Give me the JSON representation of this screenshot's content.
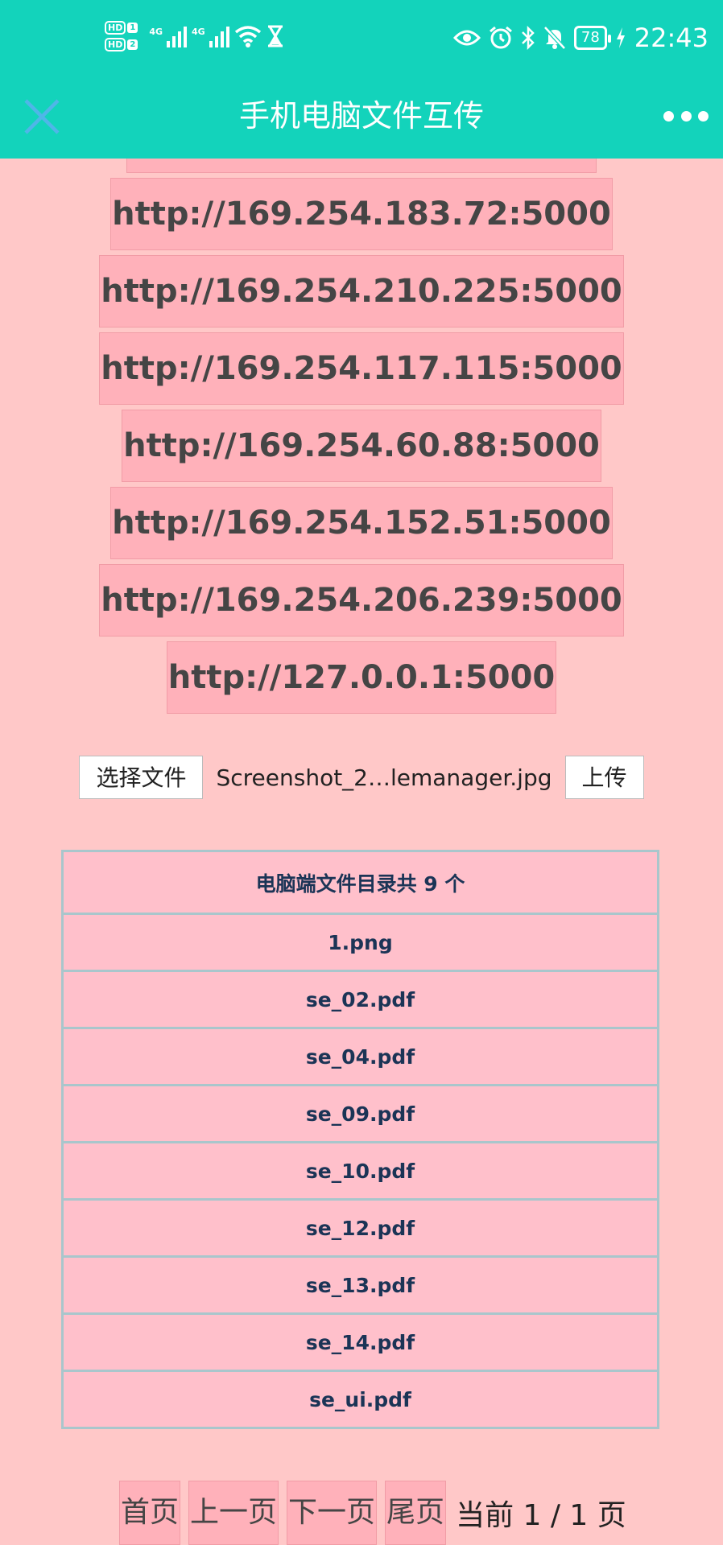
{
  "colors": {
    "accent": "#13D3BB",
    "background": "#FFC8C8",
    "url_box": "#FFB1BA",
    "table_cell": "#FFC0CB",
    "table_border": "#A9C6CC",
    "table_text": "#1B3456"
  },
  "status_bar": {
    "sim1": "HD",
    "sim1_num": "1",
    "sim2": "HD",
    "sim2_num": "2",
    "net1": "4G",
    "net2": "4G",
    "icons": [
      "eye-icon",
      "alarm-icon",
      "bluetooth-icon",
      "mute-icon"
    ],
    "battery": "78",
    "time": "22:43"
  },
  "title_bar": {
    "title": "手机电脑文件互传",
    "close_icon": "close-icon",
    "more_icon": "more-icon"
  },
  "urls": [
    "http://169.254.183.72:5000",
    "http://169.254.210.225:5000",
    "http://169.254.117.115:5000",
    "http://169.254.60.88:5000",
    "http://169.254.152.51:5000",
    "http://169.254.206.239:5000",
    "http://127.0.0.1:5000"
  ],
  "upload": {
    "choose_label": "选择文件",
    "filename": "Screenshot_2…lemanager.jpg",
    "upload_label": "上传"
  },
  "file_table": {
    "header": "电脑端文件目录共 9 个",
    "files": [
      "1.png",
      "se_02.pdf",
      "se_04.pdf",
      "se_09.pdf",
      "se_10.pdf",
      "se_12.pdf",
      "se_13.pdf",
      "se_14.pdf",
      "se_ui.pdf"
    ]
  },
  "pager": {
    "first": "首页",
    "prev": "上一页",
    "next": "下一页",
    "last": "尾页",
    "info": "当前 1 / 1 页"
  }
}
